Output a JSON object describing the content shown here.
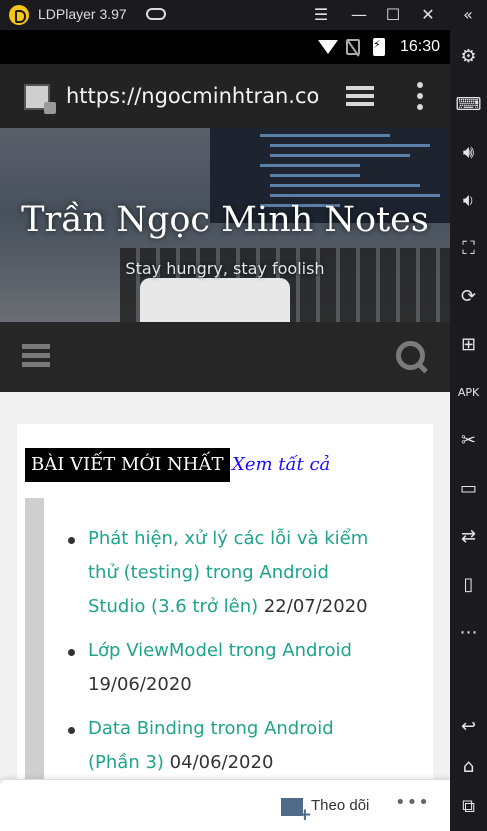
{
  "emulator": {
    "title": "LDPlayer 3.97",
    "controls": [
      "menu-icon",
      "minimize-icon",
      "maximize-icon",
      "close-icon"
    ],
    "collapse_icon": "double-chevron-left-icon",
    "side_tools": [
      "settings-icon",
      "keyboard-icon",
      "volume-up-icon",
      "volume-down-icon",
      "fullscreen-icon",
      "rotate-icon",
      "add-window-icon",
      "apk-install-icon",
      "scissors-icon",
      "record-video-icon",
      "sync-icon",
      "shake-icon",
      "more-icon",
      "back-icon",
      "home-icon",
      "recent-apps-icon"
    ]
  },
  "status_bar": {
    "time": "16:30"
  },
  "browser": {
    "url": "https://ngocminhtran.com"
  },
  "site": {
    "title": "Trần Ngọc Minh Notes",
    "tagline": "Stay hungry, stay foolish"
  },
  "widget": {
    "title": "BÀI VIẾT MỚI NHẤT",
    "view_all": "Xem tất cả",
    "posts": [
      {
        "title": "Phát hiện, xử lý các lỗi và kiểm thử (testing) trong Android Studio (3.6 trở lên)",
        "date": "22/07/2020"
      },
      {
        "title": "Lớp ViewModel trong Android",
        "date": "19/06/2020"
      },
      {
        "title": "Data Binding trong Android (Phần 3)",
        "date": "04/06/2020"
      }
    ]
  },
  "follow_bar": {
    "label": "Theo dõi",
    "more": "•••"
  },
  "colors": {
    "accent_link": "#1fa48c",
    "view_all_link": "#1a0dff",
    "nav_bg": "#262626"
  }
}
